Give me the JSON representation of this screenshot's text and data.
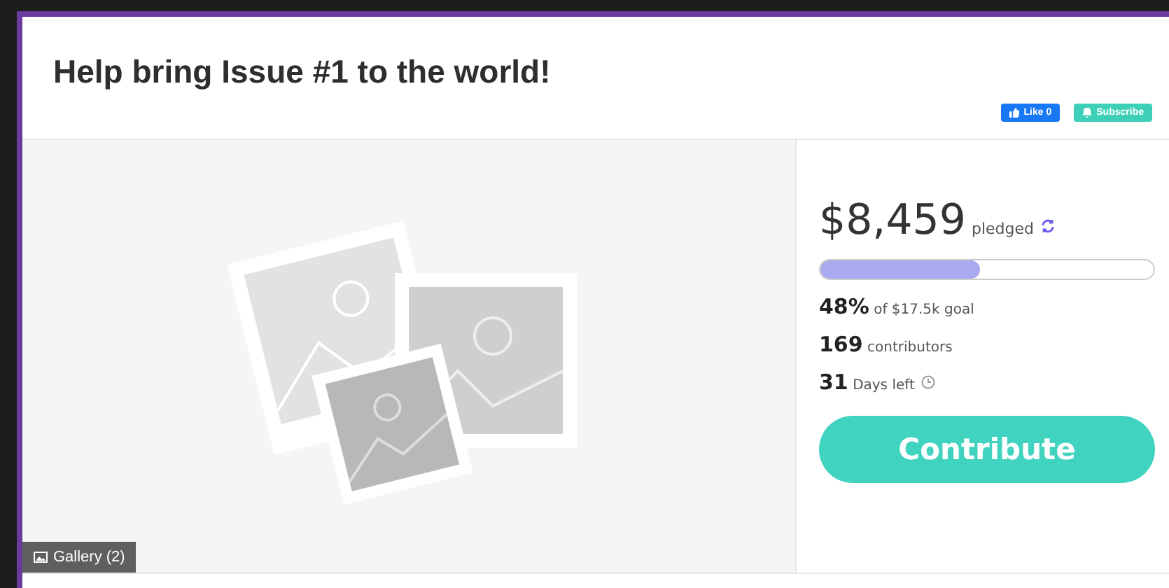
{
  "title": "Help bring Issue #1 to the world!",
  "social": {
    "like": "Like 0",
    "subscribe": "Subscribe"
  },
  "gallery": {
    "label": "Gallery (2)"
  },
  "campaign": {
    "amount": "$8,459",
    "amount_label": "pledged",
    "level": 0.48,
    "stats": [
      {
        "value": "48%",
        "text": "of $17.5k goal",
        "kind": "plain"
      },
      {
        "value": "169",
        "text": "contributors",
        "kind": "plain"
      },
      {
        "value": "31",
        "text": "Days left",
        "kind": "clock"
      }
    ],
    "button": "Contribute"
  }
}
